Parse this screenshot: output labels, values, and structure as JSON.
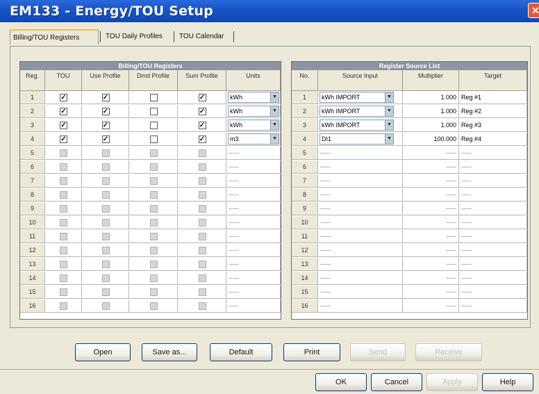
{
  "window": {
    "title": "EM133 - Energy/TOU Setup",
    "close_glyph": "✕"
  },
  "tabs": [
    {
      "label": "Billing/TOU Registers",
      "active": true
    },
    {
      "label": "TOU Daily Profiles",
      "active": false
    },
    {
      "label": "TOU Calendar",
      "active": false
    }
  ],
  "billing_table": {
    "caption": "Billing/TOU Registers",
    "headers": {
      "reg": "Reg.",
      "tou": "TOU",
      "use_profile": "Use Profile",
      "dmd_profile": "Dmd Profile",
      "sum_profile": "Sum Profile",
      "units": "Units"
    },
    "rows": [
      {
        "reg": "1",
        "tou": true,
        "use": true,
        "dmd": false,
        "sum": true,
        "units": "kWh",
        "enabled": true
      },
      {
        "reg": "2",
        "tou": true,
        "use": true,
        "dmd": false,
        "sum": true,
        "units": "kWh",
        "enabled": true
      },
      {
        "reg": "3",
        "tou": true,
        "use": true,
        "dmd": false,
        "sum": true,
        "units": "kWh",
        "enabled": true
      },
      {
        "reg": "4",
        "tou": true,
        "use": true,
        "dmd": false,
        "sum": true,
        "units": "m3",
        "enabled": true
      },
      {
        "reg": "5",
        "units": "-----",
        "enabled": false
      },
      {
        "reg": "6",
        "units": "-----",
        "enabled": false
      },
      {
        "reg": "7",
        "units": "-----",
        "enabled": false
      },
      {
        "reg": "8",
        "units": "-----",
        "enabled": false
      },
      {
        "reg": "9",
        "units": "-----",
        "enabled": false
      },
      {
        "reg": "10",
        "units": "-----",
        "enabled": false
      },
      {
        "reg": "11",
        "units": "-----",
        "enabled": false
      },
      {
        "reg": "12",
        "units": "-----",
        "enabled": false
      },
      {
        "reg": "13",
        "units": "-----",
        "enabled": false
      },
      {
        "reg": "14",
        "units": "-----",
        "enabled": false
      },
      {
        "reg": "15",
        "units": "-----",
        "enabled": false
      },
      {
        "reg": "16",
        "units": "-----",
        "enabled": false
      }
    ]
  },
  "source_table": {
    "caption": "Register Source List",
    "headers": {
      "no": "No.",
      "source": "Source Input",
      "multiplier": "Multiplier",
      "target": "Target"
    },
    "rows": [
      {
        "no": "1",
        "source": "kWh IMPORT",
        "multiplier": "1.000",
        "target": "Reg #1",
        "enabled": true
      },
      {
        "no": "2",
        "source": "kWh IMPORT",
        "multiplier": "1.000",
        "target": "Reg #2",
        "enabled": true
      },
      {
        "no": "3",
        "source": "kWh IMPORT",
        "multiplier": "1.000",
        "target": "Reg #3",
        "enabled": true
      },
      {
        "no": "4",
        "source": "DI1",
        "multiplier": "100.000",
        "target": "Reg #4",
        "enabled": true
      },
      {
        "no": "5",
        "source": "-----",
        "multiplier": "-----",
        "target": "-----",
        "enabled": false
      },
      {
        "no": "6",
        "source": "-----",
        "multiplier": "-----",
        "target": "-----",
        "enabled": false
      },
      {
        "no": "7",
        "source": "-----",
        "multiplier": "-----",
        "target": "-----",
        "enabled": false
      },
      {
        "no": "8",
        "source": "-----",
        "multiplier": "-----",
        "target": "-----",
        "enabled": false
      },
      {
        "no": "9",
        "source": "-----",
        "multiplier": "-----",
        "target": "-----",
        "enabled": false
      },
      {
        "no": "10",
        "source": "-----",
        "multiplier": "-----",
        "target": "-----",
        "enabled": false
      },
      {
        "no": "11",
        "source": "-----",
        "multiplier": "-----",
        "target": "-----",
        "enabled": false
      },
      {
        "no": "12",
        "source": "-----",
        "multiplier": "-----",
        "target": "-----",
        "enabled": false
      },
      {
        "no": "13",
        "source": "-----",
        "multiplier": "-----",
        "target": "-----",
        "enabled": false
      },
      {
        "no": "14",
        "source": "-----",
        "multiplier": "-----",
        "target": "-----",
        "enabled": false
      },
      {
        "no": "15",
        "source": "-----",
        "multiplier": "-----",
        "target": "-----",
        "enabled": false
      },
      {
        "no": "16",
        "source": "-----",
        "multiplier": "-----",
        "target": "-----",
        "enabled": false
      }
    ]
  },
  "action_buttons": [
    {
      "label": "Open",
      "disabled": false
    },
    {
      "label": "Save as...",
      "disabled": false
    },
    {
      "label": "Default",
      "disabled": false
    },
    {
      "label": "Print",
      "disabled": false
    },
    {
      "label": "Send",
      "disabled": true
    },
    {
      "label": "Receive",
      "disabled": true
    }
  ],
  "dialog_buttons": [
    {
      "label": "OK",
      "disabled": false
    },
    {
      "label": "Cancel",
      "disabled": false
    },
    {
      "label": "Apply",
      "disabled": true
    },
    {
      "label": "Help",
      "disabled": false
    }
  ],
  "icons": {
    "check": "✓",
    "dropdown_arrow": "▼"
  },
  "colors": {
    "title_bar": "#1a55c9",
    "panel_caption": "#8c93a3",
    "window_bg": "#ece9d8"
  }
}
